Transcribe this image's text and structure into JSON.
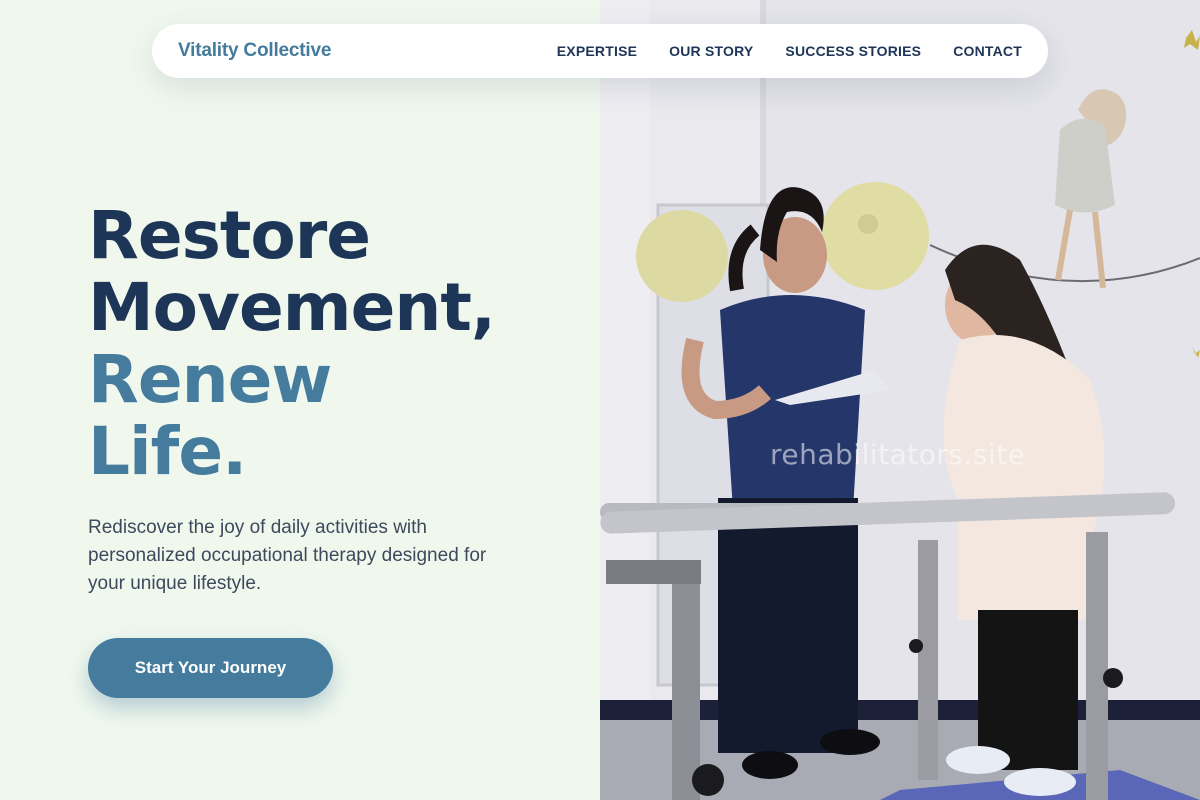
{
  "brand": {
    "name": "Vitality Collective"
  },
  "nav": {
    "items": [
      {
        "label": "EXPERTISE"
      },
      {
        "label": "OUR STORY"
      },
      {
        "label": "SUCCESS STORIES"
      },
      {
        "label": "CONTACT"
      }
    ]
  },
  "hero": {
    "title_line1": "Restore",
    "title_line2": "Movement,",
    "title_line3": "Renew",
    "title_line4": "Life.",
    "subtitle": "Rediscover the joy of daily activities with personalized occupational therapy designed for your unique lifestyle.",
    "cta_label": "Start Your Journey"
  },
  "photo": {
    "watermark": "rehabilitators.site"
  },
  "colors": {
    "background": "#f0f8ee",
    "primary_dark": "#1d3557",
    "accent": "#457b9d",
    "text_body": "#3d4a5c"
  }
}
